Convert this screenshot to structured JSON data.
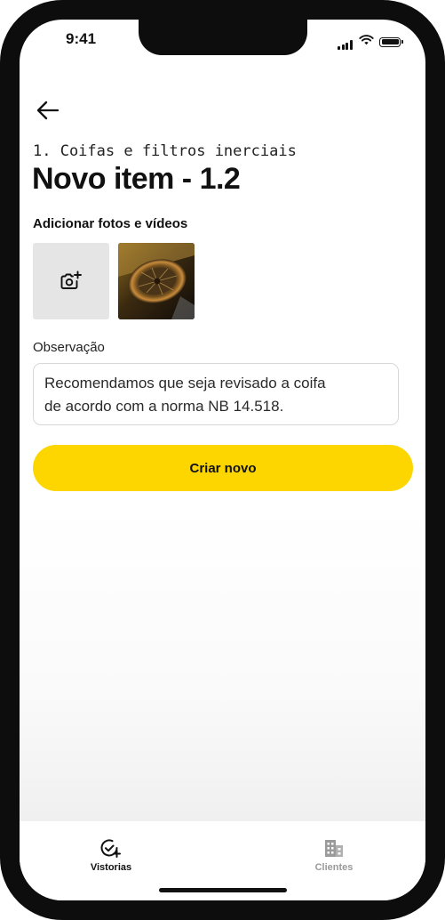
{
  "status_bar": {
    "time": "9:41"
  },
  "header": {
    "section": "1. Coifas e filtros inerciais",
    "title": "Novo item - 1.2"
  },
  "media": {
    "label": "Adicionar fotos e vídeos",
    "add_icon": "camera-plus-icon"
  },
  "observation": {
    "label": "Observação",
    "value": "Recomendamos que seja revisado a coifa\nde acordo com a norma NB 14.518."
  },
  "actions": {
    "primary_label": "Criar novo"
  },
  "bottom_nav": {
    "items": [
      {
        "label": "Vistorias",
        "icon": "check-circle-plus-icon",
        "active": true
      },
      {
        "label": "Clientes",
        "icon": "building-icon",
        "active": false
      }
    ]
  },
  "colors": {
    "accent": "#fdd600",
    "active_nav": "#111111",
    "inactive_nav": "#9a9a9a",
    "frame": "#0d0d0d"
  }
}
